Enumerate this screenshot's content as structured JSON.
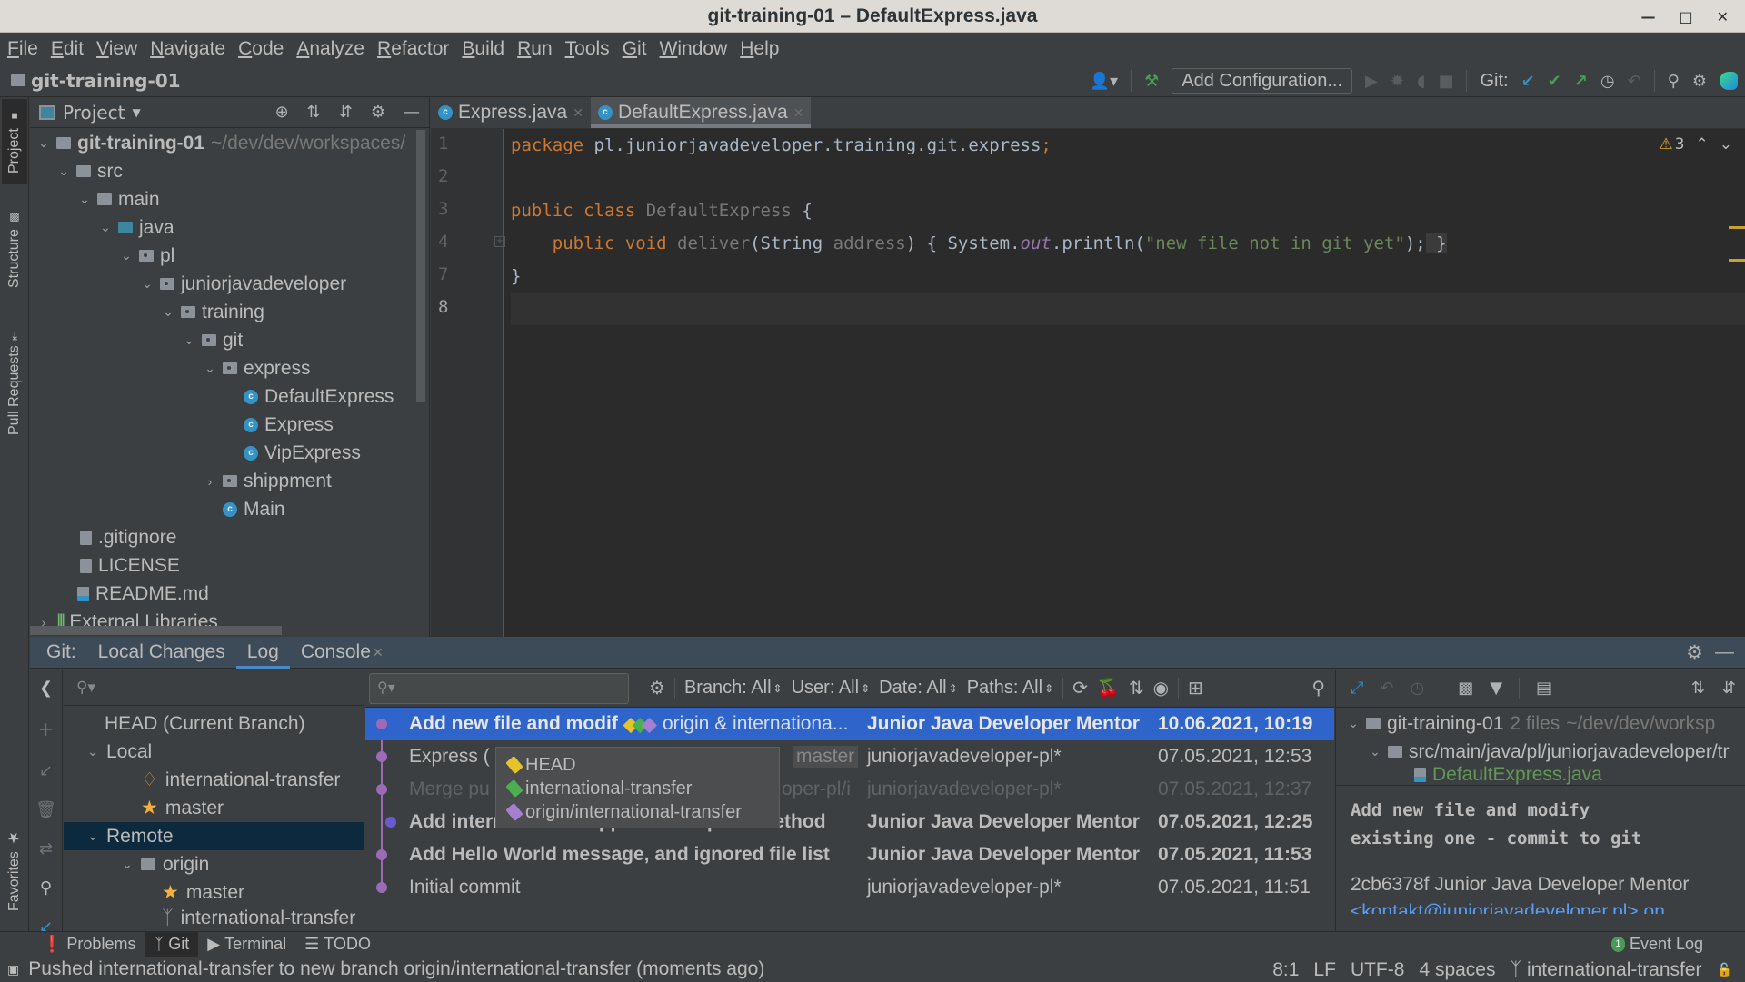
{
  "window": {
    "title": "git-training-01 – DefaultExpress.java"
  },
  "menu": [
    "File",
    "Edit",
    "View",
    "Navigate",
    "Code",
    "Analyze",
    "Refactor",
    "Build",
    "Run",
    "Tools",
    "Git",
    "Window",
    "Help"
  ],
  "navbar": {
    "project": "git-training-01",
    "add_configuration": "Add Configuration...",
    "git_label": "Git:"
  },
  "side_tabs": {
    "project": "Project",
    "structure": "Structure",
    "pull_requests": "Pull Requests",
    "favorites": "Favorites"
  },
  "project_panel": {
    "title": "Project",
    "tree": [
      {
        "label": "git-training-01",
        "hint": "~/dev/dev/workspaces/",
        "bold": true
      },
      {
        "label": "src"
      },
      {
        "label": "main"
      },
      {
        "label": "java"
      },
      {
        "label": "pl"
      },
      {
        "label": "juniorjavadeveloper"
      },
      {
        "label": "training"
      },
      {
        "label": "git"
      },
      {
        "label": "express"
      },
      {
        "label": "DefaultExpress"
      },
      {
        "label": "Express"
      },
      {
        "label": "VipExpress"
      },
      {
        "label": "shippment"
      },
      {
        "label": "Main"
      },
      {
        "label": ".gitignore"
      },
      {
        "label": "LICENSE"
      },
      {
        "label": "README.md"
      },
      {
        "label": "External Libraries"
      }
    ]
  },
  "editor": {
    "tabs": [
      {
        "label": "Express.java"
      },
      {
        "label": "DefaultExpress.java",
        "active": true
      }
    ],
    "line_numbers": [
      "1",
      "2",
      "3",
      "4",
      "7",
      "8"
    ],
    "warnings": "3",
    "code": {
      "l1_kw": "package",
      "l1_rest": " pl.juniorjavadeveloper.training.git.express",
      "l1_semi": ";",
      "l3_kw": "public class",
      "l3_name": " DefaultExpress",
      "l3_brace": " {",
      "l4_kw": "    public void",
      "l4_name": " deliver",
      "l4_paren": "(String",
      "l4_param": " address",
      "l4_close": ") { System.",
      "l4_field": "out",
      "l4_call": ".println(",
      "l4_str": "\"new file not in git yet\"",
      "l4_end": ");",
      "l4_brace": " }",
      "l7": "}"
    }
  },
  "git_window": {
    "label": "Git:",
    "tabs": [
      "Local Changes",
      "Log",
      "Console"
    ],
    "active_tab": "Log",
    "branches": {
      "head": "HEAD (Current Branch)",
      "local": "Local",
      "local_items": [
        "international-transfer",
        "master"
      ],
      "remote": "Remote",
      "origin": "origin",
      "remote_items": [
        "master",
        "international-transfer"
      ]
    },
    "log_toolbar": {
      "branch": "Branch: All",
      "user": "User: All",
      "date": "Date: All",
      "paths": "Paths: All"
    },
    "commits": [
      {
        "message": "Add new file and modif",
        "refs": "origin & internationa...",
        "author": "Junior Java Developer Mentor",
        "date": "10.06.2021, 10:19",
        "selected": true,
        "bold": true
      },
      {
        "message": "Express (",
        "refs": "master",
        "author": "juniorjavadeveloper-pl*",
        "date": "07.05.2021, 12:53"
      },
      {
        "message": "Merge pu",
        "refs": "oper-pl/i",
        "author": "juniorjavadeveloper-pl*",
        "date": "07.05.2021, 12:37",
        "dim": true
      },
      {
        "message": "Add international shippemnt template method",
        "author": "Junior Java Developer Mentor",
        "date": "07.05.2021, 12:25",
        "bold": true
      },
      {
        "message": "Add Hello World message, and ignored file list",
        "author": "Junior Java Developer Mentor",
        "date": "07.05.2021, 11:53",
        "bold": true
      },
      {
        "message": "Initial commit",
        "author": "juniorjavadeveloper-pl*",
        "date": "07.05.2021, 11:51"
      }
    ],
    "ref_popup": [
      {
        "label": "HEAD",
        "color": "#e5c32a"
      },
      {
        "label": "international-transfer",
        "color": "#4caf50"
      },
      {
        "label": "origin/international-transfer",
        "color": "#a67fcf"
      }
    ],
    "details": {
      "root": "git-training-01",
      "root_count": "2 files",
      "root_path": "~/dev/dev/worksp",
      "dir": "src/main/java/pl/juniorjavadeveloper/tr",
      "file": "DefaultExpress.java",
      "message_line1": "Add new file and modify",
      "message_line2": "existing one - commit to git",
      "hash_author": "2cb6378f Junior Java Developer Mentor",
      "email": "<kontakt@juniorjavadeveloper.pl> on"
    }
  },
  "bottom_tabs": [
    "Problems",
    "Git",
    "Terminal",
    "TODO"
  ],
  "event_log": {
    "label": "Event Log",
    "count": "1"
  },
  "status": {
    "message": "Pushed international-transfer to new branch origin/international-transfer (moments ago)",
    "position": "8:1",
    "line_sep": "LF",
    "encoding": "UTF-8",
    "indent": "4 spaces",
    "branch": "international-transfer"
  },
  "colors": {
    "accent": "#2f65ca",
    "graph": "#9d6ab8",
    "tab_underline": "#4a88c7"
  }
}
